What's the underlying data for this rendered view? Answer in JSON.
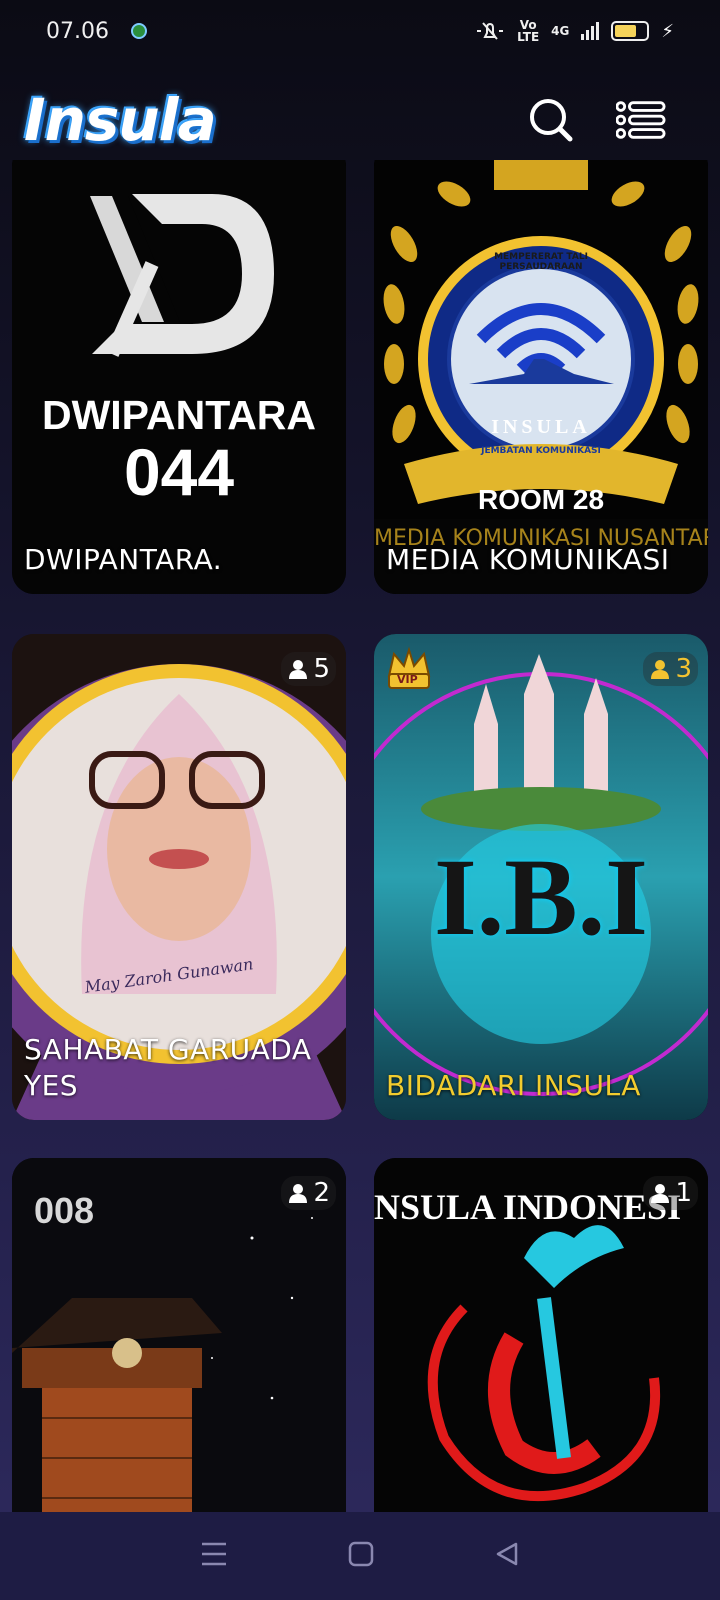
{
  "status_bar": {
    "time": "07.06",
    "volte": "Vo\nLTE",
    "network": "4G"
  },
  "header": {
    "logo": "Insula"
  },
  "rooms": [
    {
      "title": "DWIPANTARA.",
      "big_text": "DWIPANTARA",
      "number": "044",
      "count": ""
    },
    {
      "title": "MEDIA KOMUNIKASI",
      "badge_text": "ROOM 28",
      "ribbon_text": "MEDIA KOMUNIKASI NUSANTARA",
      "seal_top": "MEMPERERAT TALI PERSAUDARAAN",
      "seal_mid": "INSULA",
      "seal_bottom": "JEMBATAN KOMUNIKASI",
      "count": ""
    },
    {
      "title": "SAHABAT GARUADA YES",
      "signature": "May Zaroh Gunawan",
      "count": "5"
    },
    {
      "title": "BIDADARI INSULA",
      "big_text": "I.B.I",
      "vip": "VIP",
      "count": "3"
    },
    {
      "title": "",
      "number": "008",
      "count": "2"
    },
    {
      "title": "",
      "banner_text": "NSULA INDONESI",
      "count": "1"
    }
  ],
  "colors": {
    "accent_yellow": "#f2c230",
    "card_title": "#ffffff",
    "highlight_title": "#f2cc2e",
    "logo_blue": "#1b6ecb"
  }
}
